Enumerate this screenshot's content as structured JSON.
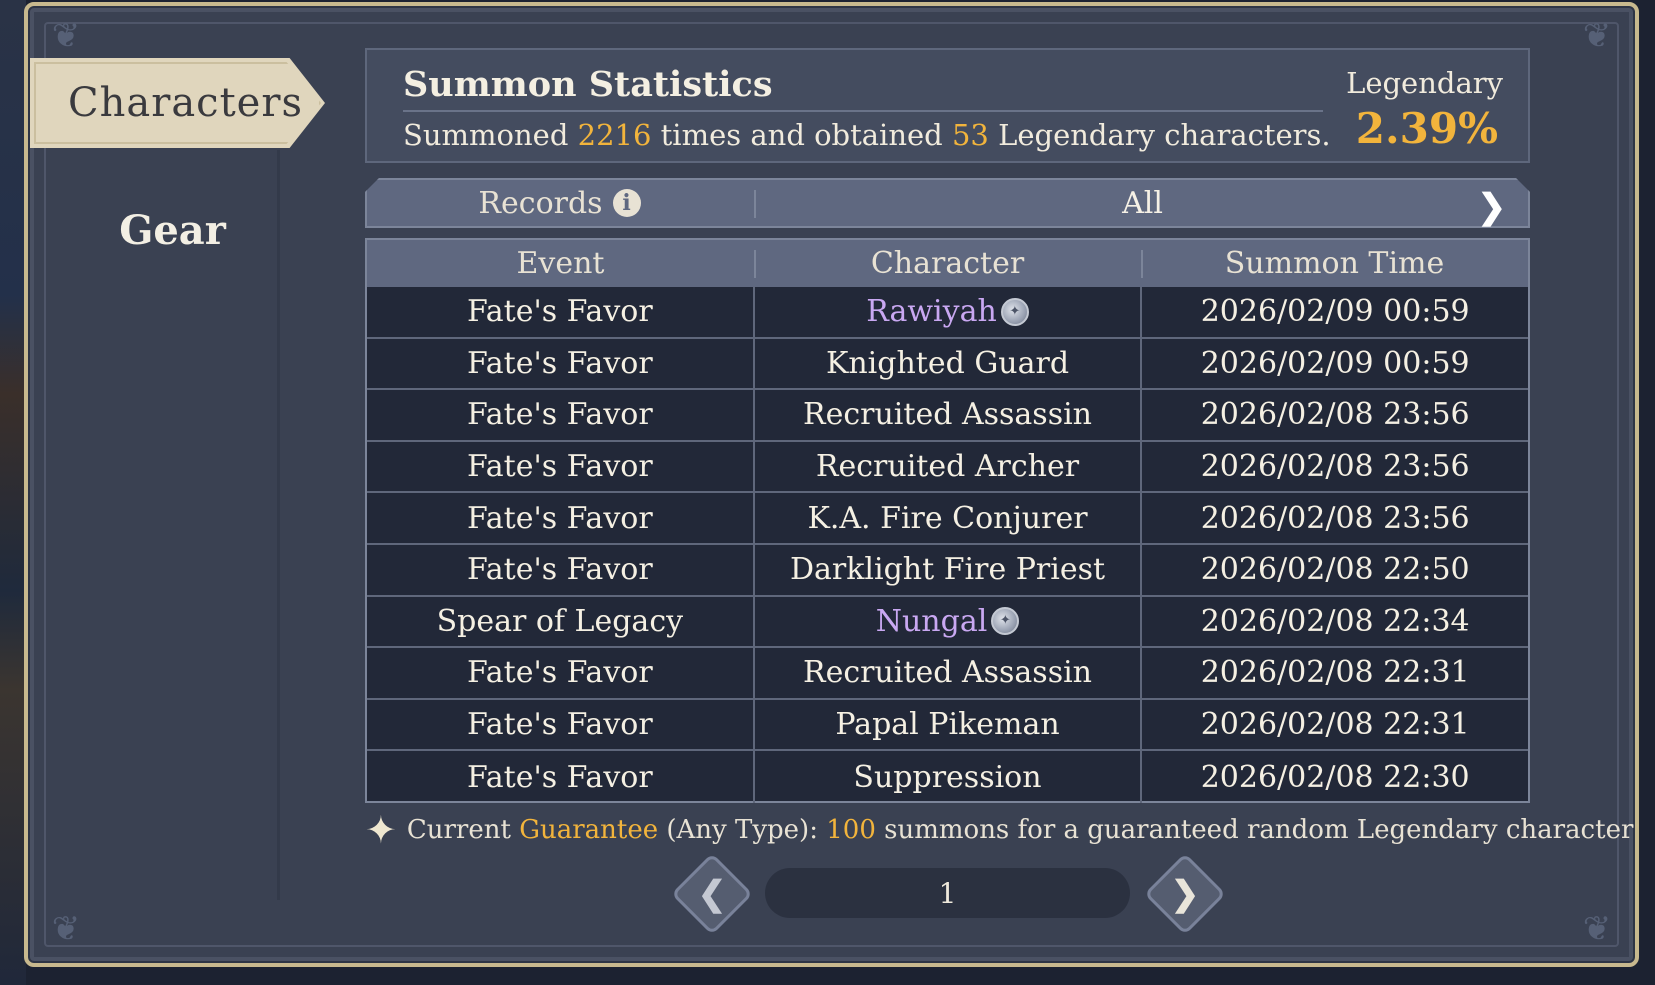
{
  "sidebar": {
    "tabs": [
      {
        "label": "Characters",
        "active": true
      },
      {
        "label": "Gear",
        "active": false
      }
    ]
  },
  "stats": {
    "title": "Summon Statistics",
    "line_prefix": "Summoned ",
    "summon_count": "2216",
    "line_middle": " times and obtained ",
    "legendary_count": "53",
    "line_suffix": " Legendary characters.",
    "legendary_label": "Legendary",
    "legendary_rate": "2.39%"
  },
  "filter": {
    "records_label": "Records",
    "info_icon": "info-icon",
    "selected": "All",
    "next_icon": "chevron-right-icon"
  },
  "table": {
    "headers": [
      "Event",
      "Character",
      "Summon Time"
    ],
    "rows": [
      {
        "event": "Fate's Favor",
        "character": "Rawiyah",
        "legendary": true,
        "time": "2026/02/09 00:59"
      },
      {
        "event": "Fate's Favor",
        "character": "Knighted Guard",
        "legendary": false,
        "time": "2026/02/09 00:59"
      },
      {
        "event": "Fate's Favor",
        "character": "Recruited Assassin",
        "legendary": false,
        "time": "2026/02/08 23:56"
      },
      {
        "event": "Fate's Favor",
        "character": "Recruited Archer",
        "legendary": false,
        "time": "2026/02/08 23:56"
      },
      {
        "event": "Fate's Favor",
        "character": "K.A. Fire Conjurer",
        "legendary": false,
        "time": "2026/02/08 23:56"
      },
      {
        "event": "Fate's Favor",
        "character": "Darklight Fire Priest",
        "legendary": false,
        "time": "2026/02/08 22:50"
      },
      {
        "event": "Spear of Legacy",
        "character": "Nungal",
        "legendary": true,
        "time": "2026/02/08 22:34"
      },
      {
        "event": "Fate's Favor",
        "character": "Recruited Assassin",
        "legendary": false,
        "time": "2026/02/08 22:31"
      },
      {
        "event": "Fate's Favor",
        "character": "Papal Pikeman",
        "legendary": false,
        "time": "2026/02/08 22:31"
      },
      {
        "event": "Fate's Favor",
        "character": "Suppression",
        "legendary": false,
        "time": "2026/02/08 22:30"
      }
    ]
  },
  "guarantee": {
    "prefix": "Current ",
    "highlight": "Guarantee",
    "middle": " (Any Type): ",
    "count": "100",
    "suffix": " summons for a guaranteed random Legendary character"
  },
  "pagination": {
    "current_page": "1",
    "prev_icon": "chevron-left-icon",
    "next_icon": "chevron-right-icon"
  },
  "colors": {
    "gold": "#f2b43c",
    "legendary_name": "#c9a8f2",
    "panel": "#3a4152",
    "header": "#5f6880"
  }
}
